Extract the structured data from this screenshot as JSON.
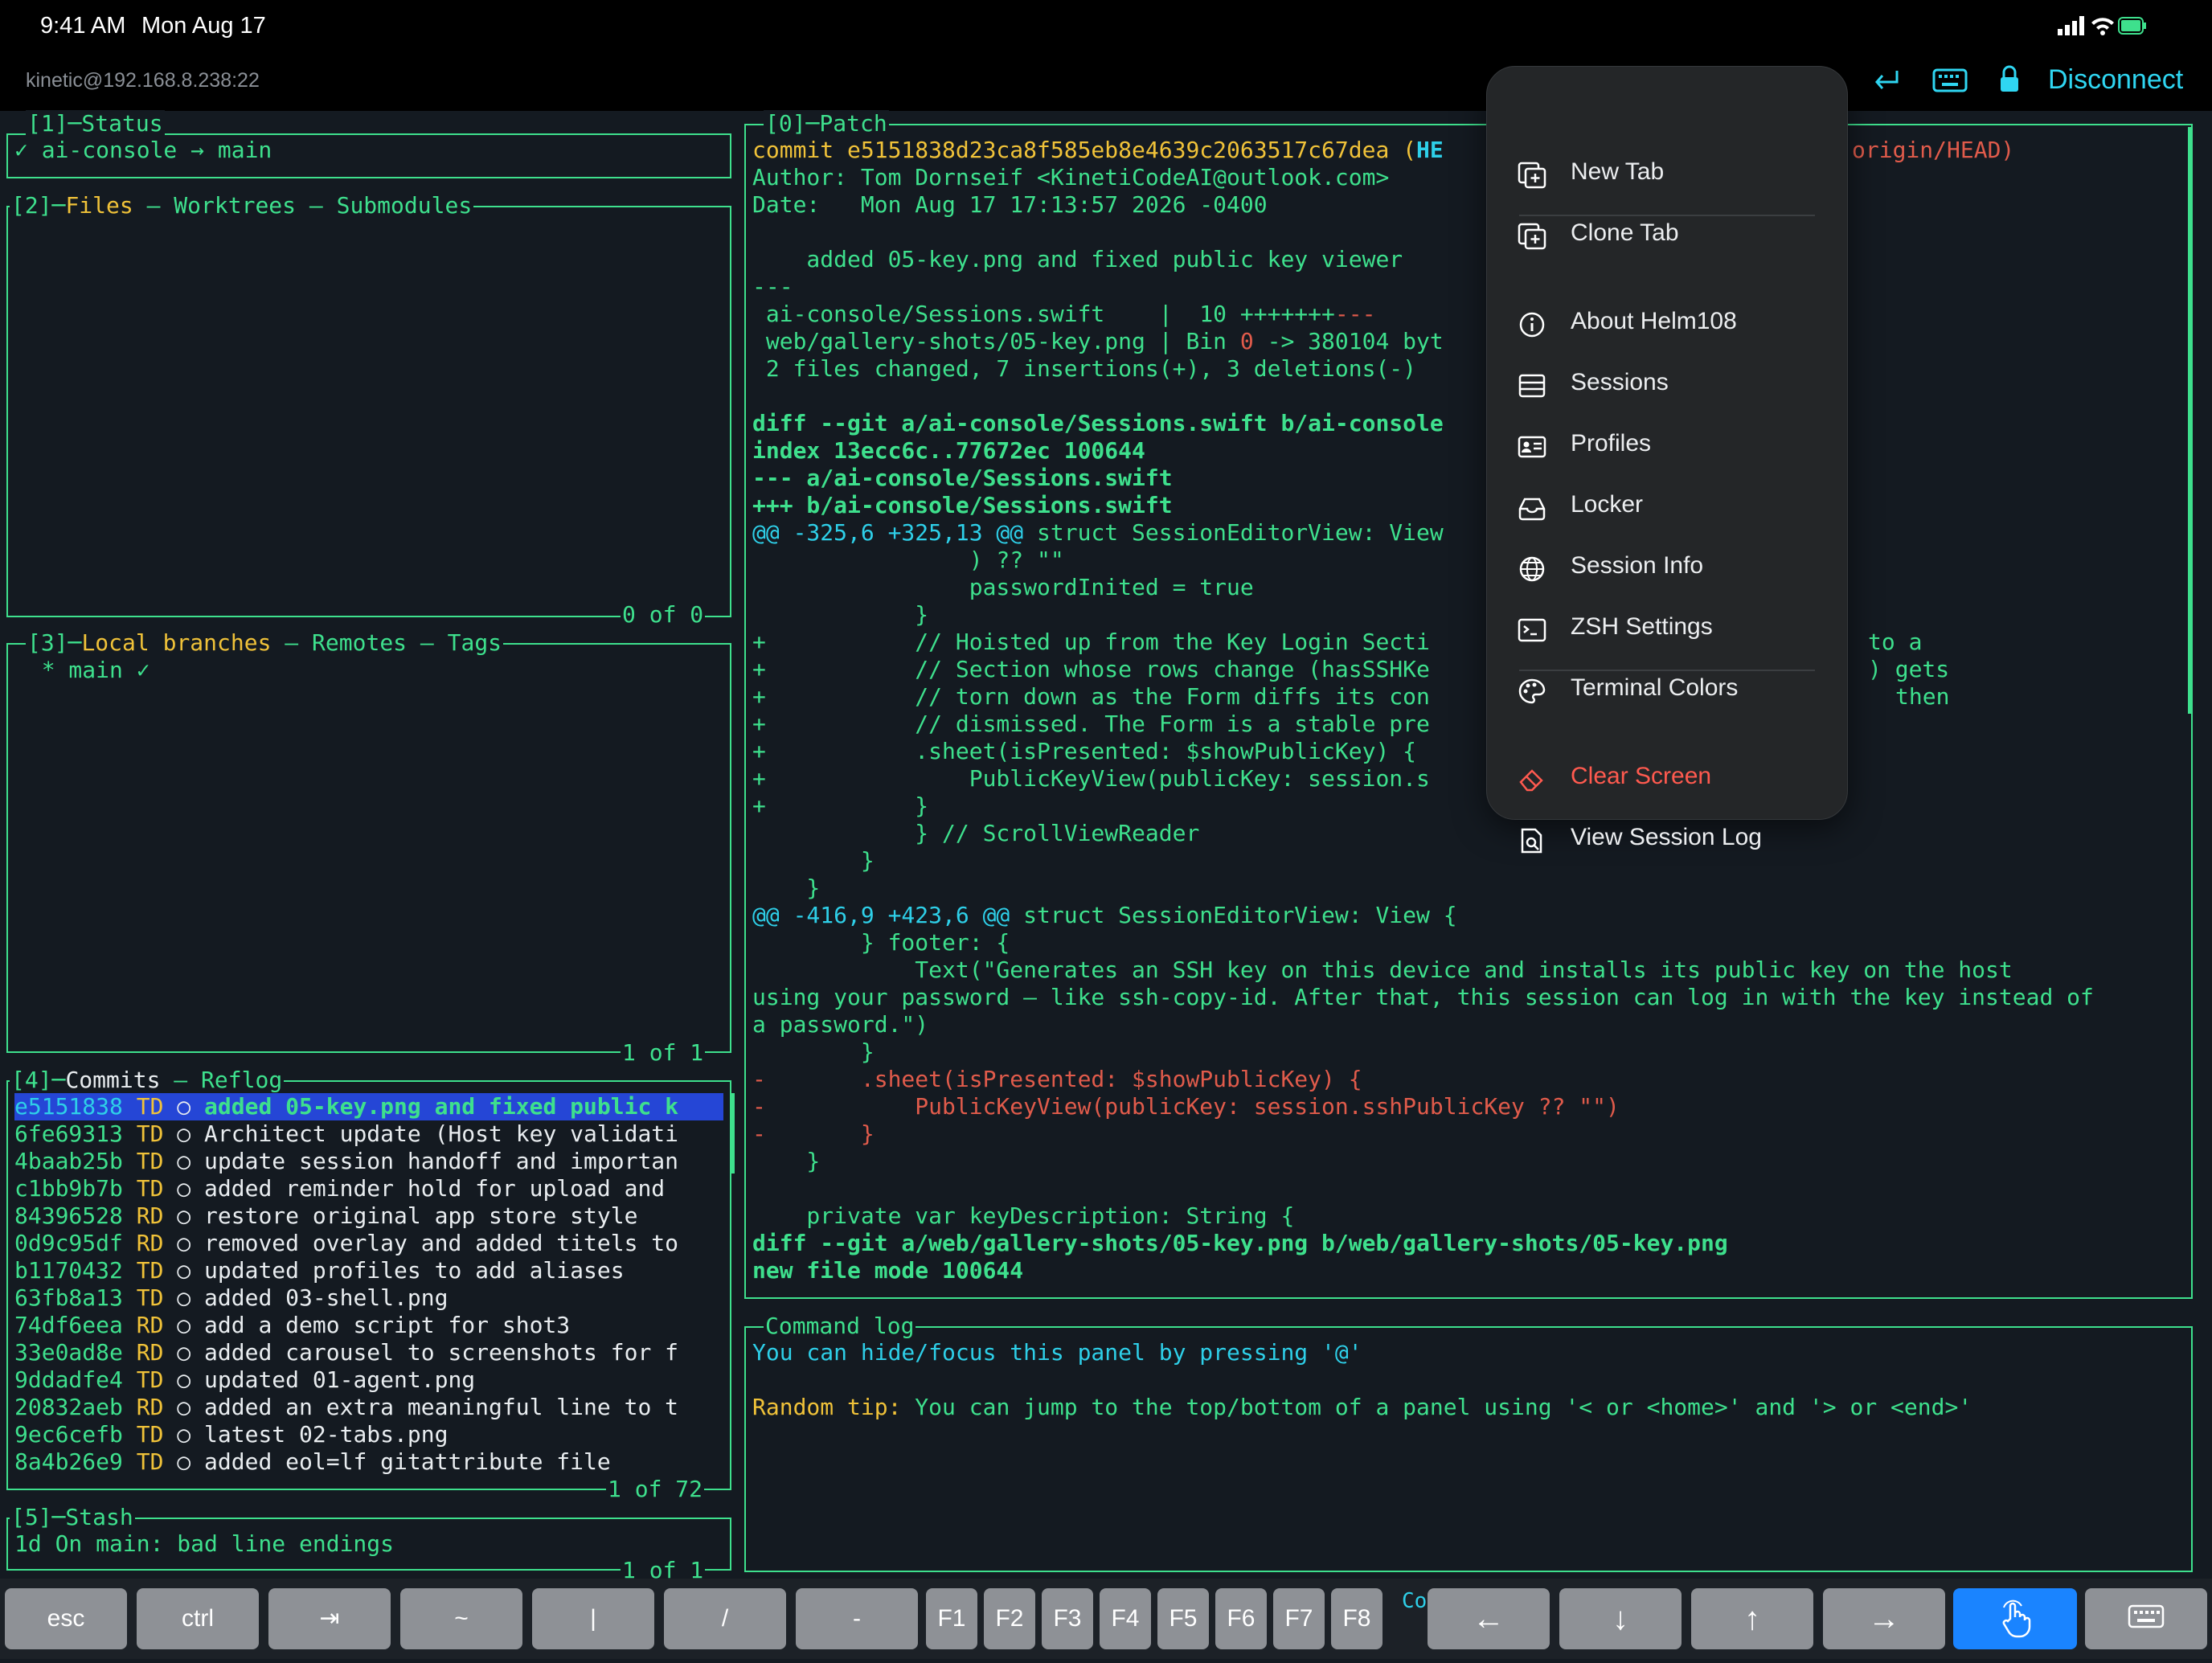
{
  "status_bar": {
    "time": "9:41 AM",
    "date": "Mon Aug 17"
  },
  "host": "kinetic@192.168.8.238:22",
  "top_actions": {
    "disconnect": "Disconnect"
  },
  "panels": {
    "status": {
      "title": "[1]─Status",
      "line": "✓ ai-console → main"
    },
    "files": {
      "title_num": "[2]─",
      "title_files": "Files",
      "title_rest": " – Worktrees – Submodules",
      "footer": "0 of 0"
    },
    "branches": {
      "title_num": "[3]─",
      "title_local": "Local branches",
      "title_rest": " – Remotes – Tags",
      "line": "  * main ✓",
      "footer": "1 of 1"
    },
    "commits": {
      "title_num": "[4]─",
      "title_commits": "Commits",
      "title_rest": " – Reflog",
      "footer": "1 of 72",
      "rows": [
        {
          "hash": "e5151838",
          "author": "TD",
          "msg": "added 05-key.png and fixed public k"
        },
        {
          "hash": "6fe69313",
          "author": "TD",
          "msg": "Architect update (Host key validati"
        },
        {
          "hash": "4baab25b",
          "author": "TD",
          "msg": "update session handoff and importan"
        },
        {
          "hash": "c1bb9b7b",
          "author": "TD",
          "msg": "added reminder hold for upload and "
        },
        {
          "hash": "84396528",
          "author": "RD",
          "msg": "restore original app store style"
        },
        {
          "hash": "0d9c95df",
          "author": "RD",
          "msg": "removed overlay and added titels to"
        },
        {
          "hash": "b1170432",
          "author": "TD",
          "msg": "updated profiles to add aliases"
        },
        {
          "hash": "63fb8a13",
          "author": "TD",
          "msg": "added 03-shell.png"
        },
        {
          "hash": "74df6eea",
          "author": "RD",
          "msg": "add a demo script for shot3"
        },
        {
          "hash": "33e0ad8e",
          "author": "RD",
          "msg": "added carousel to screenshots for f"
        },
        {
          "hash": "9ddadfe4",
          "author": "TD",
          "msg": "updated 01-agent.png"
        },
        {
          "hash": "20832aeb",
          "author": "RD",
          "msg": "added an extra meaningful line to t"
        },
        {
          "hash": "9ec6cefb",
          "author": "TD",
          "msg": "latest 02-tabs.png"
        },
        {
          "hash": "8a4b26e9",
          "author": "TD",
          "msg": "added eol=lf gitattribute file"
        }
      ]
    },
    "stash": {
      "title": "[5]─Stash",
      "line": "1d On main: bad line endings",
      "footer": "1 of 1"
    },
    "patch": {
      "title": "[0]─Patch",
      "commit_prefix": "commit e5151838d23ca8f585eb8e4639c2063517c67dea (",
      "commit_head": "HE",
      "commit_suffix": "origin/HEAD)",
      "author": "Author: Tom Dornseif <KinetiCodeAI@outlook.com>",
      "date": "Date:   Mon Aug 17 17:13:57 2026 -0400",
      "message": "    added 05-key.png and fixed public key viewer",
      "sep": "---",
      "stat1_a": " ai-console/Sessions.swift    |  10 ",
      "stat1_plus": "+++++++",
      "stat1_minus": "---",
      "stat2_a": " web/gallery-shots/05-key.png | Bin ",
      "stat2_zero": "0",
      "stat2_b": " -> 380104 byt",
      "summary": " 2 files changed, 7 insertions(+), 3 deletions(-)",
      "diff1": "diff --git a/ai-console/Sessions.swift b/ai-console",
      "index1": "index 13ecc6c..77672ec 100644",
      "minus_file": "--- a/ai-console/Sessions.swift",
      "plus_file": "+++ b/ai-console/Sessions.swift",
      "hunk1_a": "@@ -325,6 +325,13 @@",
      "hunk1_b": " struct SessionEditorView: View",
      "ctx1": "                ) ?? \"\"",
      "ctx2": "                passwordInited = true",
      "ctx3": "            }",
      "add1_a": "+           // Hoisted up from the Key Login Secti",
      "add1_b": "to a",
      "add2_a": "+           // Section whose rows change (hasSSHKe",
      "add2_b": ") gets",
      "add3_a": "+           // torn down as the Form diffs its con",
      "add3_b": "then",
      "add4": "+           // dismissed. The Form is a stable pre",
      "add5": "+           .sheet(isPresented: $showPublicKey) {",
      "add6": "+               PublicKeyView(publicKey: session.s",
      "add7": "+           }",
      "ctx4": "            } // ScrollViewReader",
      "ctx5": "        }",
      "ctx6": "    }",
      "hunk2_a": "@@ -416,9 +423,6 @@",
      "hunk2_b": " struct SessionEditorView: View {",
      "ctx7": "        } footer: {",
      "ctx8": "            Text(\"Generates an SSH key on this device and installs its public key on the host",
      "ctx9": "using your password — like ssh-copy-id. After that, this session can log in with the key instead of",
      "ctx10": "a password.\")",
      "ctx11": "        }",
      "del1": "-       .sheet(isPresented: $showPublicKey) {",
      "del2": "-           PublicKeyView(publicKey: session.sshPublicKey ?? \"\")",
      "del3": "-       }",
      "ctx12": "    }",
      "ctx13": "    private var keyDescription: String {",
      "diff2": "diff --git a/web/gallery-shots/05-key.png b/web/gallery-shots/05-key.png",
      "newmode": "new file mode 100644"
    },
    "command_log": {
      "title": "Command log",
      "line1": "You can hide/focus this panel by pressing '@'",
      "tip_label": "Random tip:",
      "tip_text": " You can jump to the top/bottom of a panel using '< or <home>' and '> or <end>'"
    }
  },
  "menu": {
    "items": [
      {
        "label": "New Tab",
        "icon": "new-tab-icon"
      },
      {
        "label": "Clone Tab",
        "icon": "clone-tab-icon"
      },
      {
        "label": "About Helm108",
        "icon": "info-icon"
      },
      {
        "label": "Sessions",
        "icon": "sessions-icon"
      },
      {
        "label": "Profiles",
        "icon": "profiles-icon"
      },
      {
        "label": "Locker",
        "icon": "locker-icon"
      },
      {
        "label": "Session Info",
        "icon": "globe-icon"
      },
      {
        "label": "ZSH Settings",
        "icon": "terminal-icon"
      },
      {
        "label": "Terminal Colors",
        "icon": "palette-icon"
      },
      {
        "label": "Clear Screen",
        "icon": "eraser-icon"
      },
      {
        "label": "View Session Log",
        "icon": "log-icon"
      }
    ],
    "destructive_color": "#ff5a4f"
  },
  "keyboard_bar": {
    "keys": [
      "esc",
      "ctrl",
      "⇥",
      "~",
      "|",
      "/",
      "-",
      "F1",
      "F2",
      "F3",
      "F4",
      "F5",
      "F6",
      "F7",
      "F8",
      "←",
      "↓",
      "↑",
      "→"
    ],
    "partial_text": "Co"
  },
  "colors": {
    "accent": "#2fd6f2",
    "terminal_green": "#3ee08d",
    "selected_row": "#2546d6",
    "active_key": "#1a84ff"
  }
}
